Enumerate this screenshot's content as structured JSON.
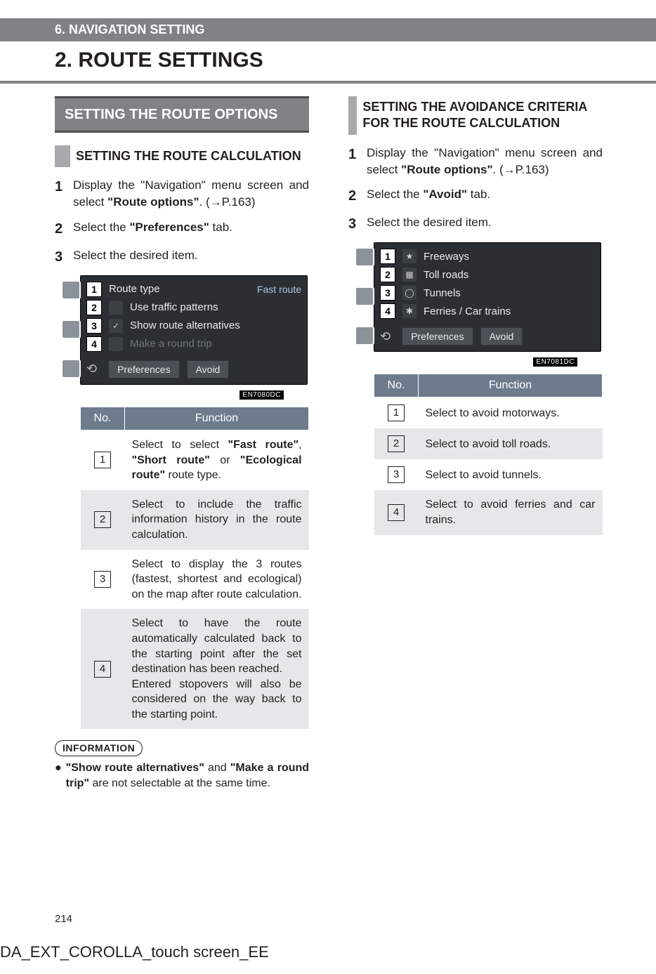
{
  "header": {
    "section": "6. NAVIGATION SETTING",
    "title": "2. ROUTE SETTINGS"
  },
  "left": {
    "h2": "SETTING THE ROUTE OPTIONS",
    "h3": "SETTING THE ROUTE CALCULATION",
    "steps": {
      "s1a": "Display the \"Navigation\" menu screen and select ",
      "s1b": "\"Route options\"",
      "s1c": ". (→P.163)",
      "s2a": "Select the ",
      "s2b": "\"Preferences\"",
      "s2c": " tab.",
      "s3": "Select the desired item."
    },
    "shot": {
      "r1": "Route type",
      "r1v": "Fast route",
      "r2": "Use traffic patterns",
      "r3": "Show route alternatives",
      "r4": "Make a round trip",
      "tab1": "Preferences",
      "tab2": "Avoid",
      "code": "EN7080DC"
    },
    "th_no": "No.",
    "th_fn": "Function",
    "rows": {
      "f1a": "Select to select ",
      "f1b": "\"Fast route\"",
      "f1c": ", ",
      "f1d": "\"Short route\"",
      "f1e": " or ",
      "f1f": "\"Ecological route\"",
      "f1g": " route type.",
      "f2": "Select to include the traffic information history in the route calculation.",
      "f3": "Select to display the 3 routes (fastest, shortest and ecological) on the map after route calculation.",
      "f4a": "Select to have the route automatically calculated back to the starting point after the set destination has been reached.",
      "f4b": "Entered stopovers will also be considered on the way back to the starting point."
    },
    "info": {
      "label": "INFORMATION",
      "p1": "\"Show route alternatives\"",
      "p2": " and ",
      "p3": "\"Make a round trip\"",
      "p4": " are not selectable at the same time."
    }
  },
  "right": {
    "h3": "SETTING THE AVOIDANCE CRITERIA FOR THE ROUTE CALCULATION",
    "steps": {
      "s1a": "Display the \"Navigation\" menu screen and select ",
      "s1b": "\"Route options\"",
      "s1c": ". (→P.163)",
      "s2a": "Select the ",
      "s2b": "\"Avoid\"",
      "s2c": " tab.",
      "s3": "Select the desired item."
    },
    "shot": {
      "r1": "Freeways",
      "r2": "Toll roads",
      "r3": "Tunnels",
      "r4": "Ferries / Car trains",
      "tab1": "Preferences",
      "tab2": "Avoid",
      "code": "EN7081DC"
    },
    "th_no": "No.",
    "th_fn": "Function",
    "rows": {
      "f1": "Select to avoid motorways.",
      "f2": "Select to avoid toll roads.",
      "f3": "Select to avoid tunnels.",
      "f4": "Select to avoid ferries and car trains."
    }
  },
  "page_number": "214",
  "footer": "DA_EXT_COROLLA_touch screen_EE"
}
